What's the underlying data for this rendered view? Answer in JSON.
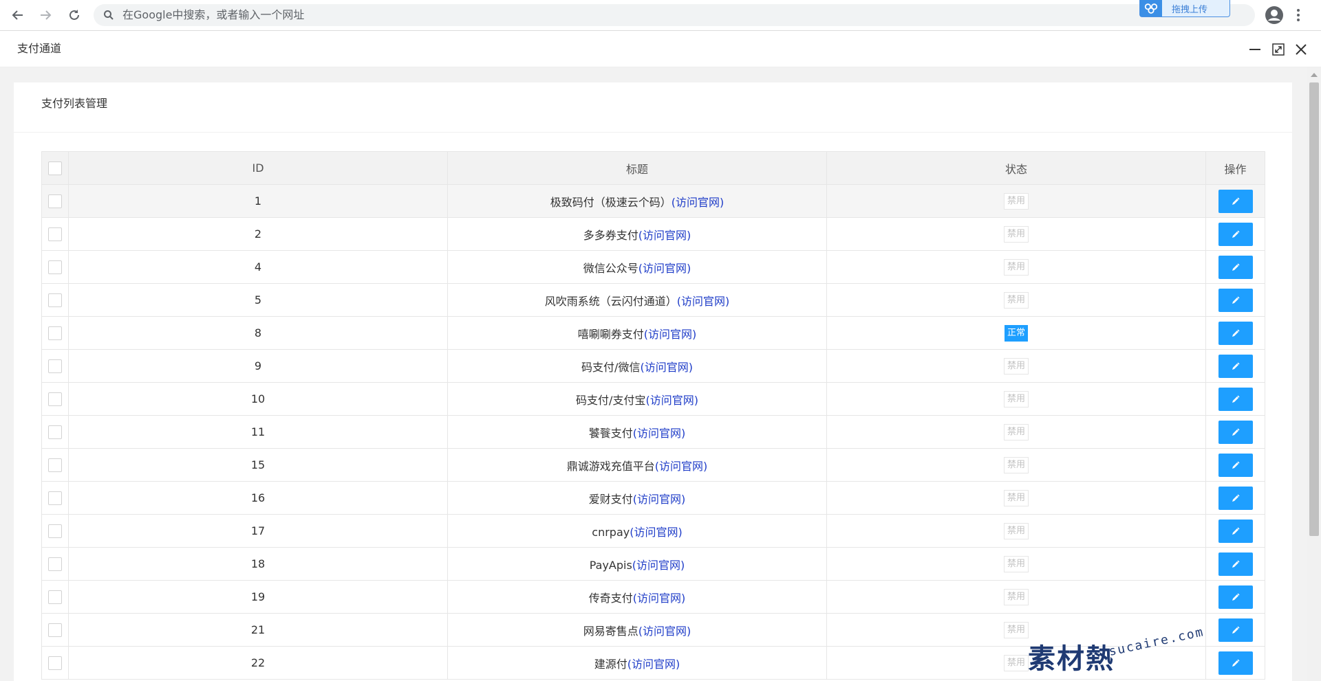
{
  "browser": {
    "omnibox_placeholder": "在Google中搜索，或者输入一个网址",
    "upload_widget_label": "拖拽上传"
  },
  "window": {
    "title": "支付通道"
  },
  "panel": {
    "title": "支付列表管理"
  },
  "table": {
    "columns": [
      "ID",
      "标题",
      "状态",
      "操作"
    ],
    "link_text": "(访问官网)",
    "rows": [
      {
        "id": "1",
        "title": "极致码付（极速云个码）",
        "status": "禁用",
        "enabled": false
      },
      {
        "id": "2",
        "title": "多多券支付",
        "status": "禁用",
        "enabled": false
      },
      {
        "id": "4",
        "title": "微信公众号",
        "status": "禁用",
        "enabled": false
      },
      {
        "id": "5",
        "title": "风吹雨系统（云闪付通道）",
        "status": "禁用",
        "enabled": false
      },
      {
        "id": "8",
        "title": "嘻唰唰券支付",
        "status": "正常",
        "enabled": true
      },
      {
        "id": "9",
        "title": "码支付/微信",
        "status": "禁用",
        "enabled": false
      },
      {
        "id": "10",
        "title": "码支付/支付宝",
        "status": "禁用",
        "enabled": false
      },
      {
        "id": "11",
        "title": "饕餮支付",
        "status": "禁用",
        "enabled": false
      },
      {
        "id": "15",
        "title": "鼎诚游戏充值平台",
        "status": "禁用",
        "enabled": false
      },
      {
        "id": "16",
        "title": "爱财支付",
        "status": "禁用",
        "enabled": false
      },
      {
        "id": "17",
        "title": "cnrpay",
        "status": "禁用",
        "enabled": false
      },
      {
        "id": "18",
        "title": "PayApis",
        "status": "禁用",
        "enabled": false
      },
      {
        "id": "19",
        "title": "传奇支付",
        "status": "禁用",
        "enabled": false
      },
      {
        "id": "21",
        "title": "网易寄售点",
        "status": "禁用",
        "enabled": false
      },
      {
        "id": "22",
        "title": "建源付",
        "status": "禁用",
        "enabled": false
      }
    ]
  },
  "watermark": {
    "main": "素材熱",
    "sub": "sucaire.com"
  },
  "colors": {
    "accent": "#1e9fff",
    "link": "#1e3cc8",
    "header_bg": "#f2f2f2"
  },
  "icons": [
    "back-arrow-icon",
    "forward-arrow-icon",
    "reload-icon",
    "search-icon",
    "cloud-icon",
    "profile-icon",
    "kebab-menu-icon",
    "minimize-icon",
    "maximize-icon",
    "close-icon",
    "pencil-icon"
  ]
}
